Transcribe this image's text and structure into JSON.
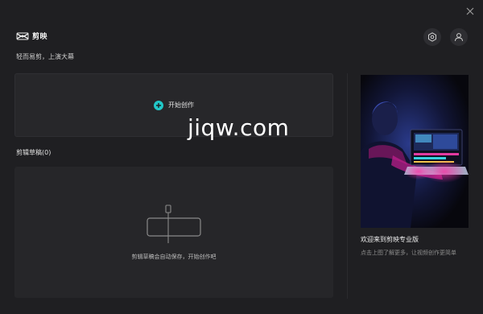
{
  "window": {
    "close_label": "×"
  },
  "brand": {
    "name": "剪映",
    "slogan": "轻而易剪，上演大幕"
  },
  "header": {
    "settings_icon": "gear-icon",
    "user_icon": "user-icon"
  },
  "create": {
    "label": "开始创作",
    "accent": "#21c8c8"
  },
  "drafts": {
    "title": "剪辑草稿(0)",
    "empty_text": "剪辑草稿会自动保存，开始创作吧"
  },
  "promo": {
    "title": "欢迎来到剪映专业版",
    "desc": "点击上图了解更多，让视频创作更简单"
  },
  "watermark": {
    "text": "jiqw.com"
  }
}
